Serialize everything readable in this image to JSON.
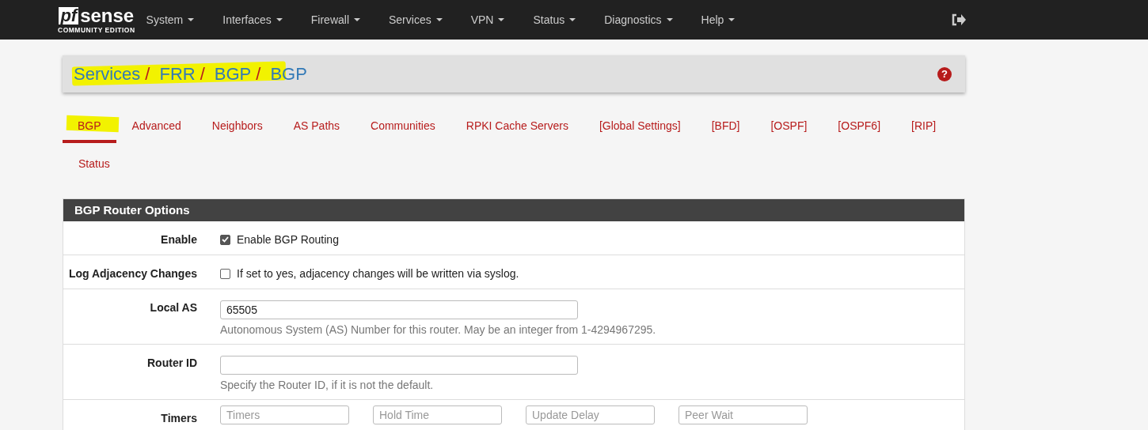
{
  "logo": {
    "mark": "pf",
    "name": "sense",
    "edition": "COMMUNITY EDITION"
  },
  "menu": [
    "System",
    "Interfaces",
    "Firewall",
    "Services",
    "VPN",
    "Status",
    "Diagnostics",
    "Help"
  ],
  "breadcrumb": {
    "highlighted": true,
    "separator": "/",
    "items": [
      "Services",
      "FRR",
      "BGP",
      "BGP"
    ],
    "help": "?"
  },
  "tabs": [
    {
      "label": "BGP",
      "selected": true,
      "highlighted": true
    },
    {
      "label": "Advanced",
      "selected": false,
      "highlighted": false
    },
    {
      "label": "Neighbors",
      "selected": false,
      "highlighted": false
    },
    {
      "label": "AS Paths",
      "selected": false,
      "highlighted": false
    },
    {
      "label": "Communities",
      "selected": false,
      "highlighted": false
    },
    {
      "label": "RPKI Cache Servers",
      "selected": false,
      "highlighted": false
    },
    {
      "label": "[Global Settings]",
      "selected": false,
      "highlighted": false
    },
    {
      "label": "[BFD]",
      "selected": false,
      "highlighted": false
    },
    {
      "label": "[OSPF]",
      "selected": false,
      "highlighted": false
    },
    {
      "label": "[OSPF6]",
      "selected": false,
      "highlighted": false
    },
    {
      "label": "[RIP]",
      "selected": false,
      "highlighted": false
    },
    {
      "label": "Status",
      "selected": false,
      "highlighted": false
    }
  ],
  "panel": {
    "title": "BGP Router Options",
    "rows": [
      {
        "kind": "checkbox",
        "label": "Enable",
        "checked": true,
        "text": "Enable BGP Routing"
      },
      {
        "kind": "checkbox",
        "label": "Log Adjacency Changes",
        "checked": false,
        "text": "If set to yes, adjacency changes will be written via syslog."
      },
      {
        "kind": "input",
        "label": "Local AS",
        "value": "65505",
        "help": "Autonomous System (AS) Number for this router. May be an integer from 1-4294967295."
      },
      {
        "kind": "input",
        "label": "Router ID",
        "help": "Specify the Router ID, if it is not the default."
      },
      {
        "kind": "inputs",
        "label": "Timers",
        "placeholders": [
          "Timers",
          "Hold Time",
          "Update Delay",
          "Peer Wait"
        ]
      }
    ]
  }
}
